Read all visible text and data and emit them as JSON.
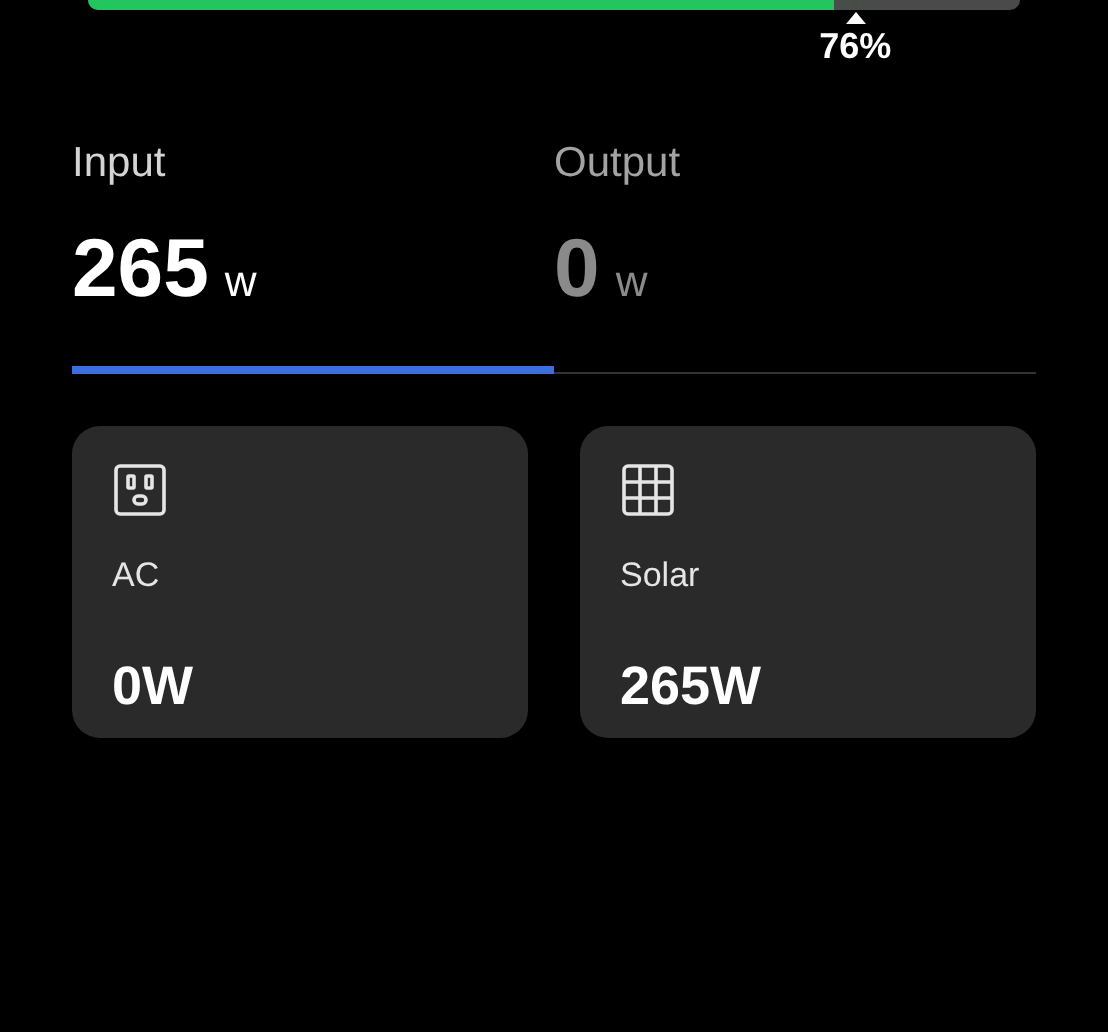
{
  "battery": {
    "level": 0.8,
    "percent": "76%"
  },
  "tabs": [
    {
      "label": "Input",
      "value": "265",
      "unit": "w",
      "selected": true
    },
    {
      "label": "Output",
      "value": "0",
      "unit": "w",
      "selected": false
    }
  ],
  "sources": [
    {
      "kind": "ac",
      "label": "AC",
      "power": "0W"
    },
    {
      "kind": "solar",
      "label": "Solar",
      "power": "265W"
    }
  ]
}
